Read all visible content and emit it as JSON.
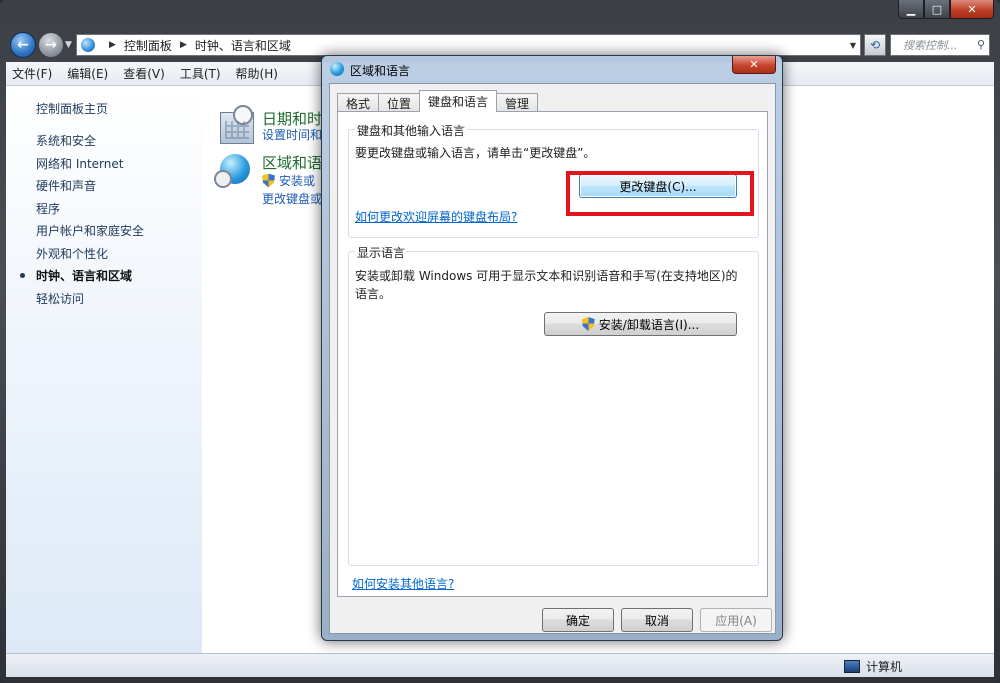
{
  "explorer": {
    "caption": {
      "minimize": "▁",
      "maximize": "□",
      "close": "✕"
    },
    "address": {
      "root": "控制面板",
      "current": "时钟、语言和区域"
    },
    "search_placeholder": "搜索控制...",
    "menu": [
      "文件(F)",
      "编辑(E)",
      "查看(V)",
      "工具(T)",
      "帮助(H)"
    ],
    "sidebar": {
      "home": "控制面板主页",
      "items": [
        {
          "label": "系统和安全"
        },
        {
          "label": "网络和 Internet"
        },
        {
          "label": "硬件和声音"
        },
        {
          "label": "程序"
        },
        {
          "label": "用户帐户和家庭安全"
        },
        {
          "label": "外观和个性化"
        },
        {
          "label": "时钟、语言和区域",
          "active": true
        },
        {
          "label": "轻松访问"
        }
      ]
    },
    "main": {
      "date_time": {
        "title": "日期和时",
        "link1": "设置时间和"
      },
      "region": {
        "title": "区域和语",
        "link1": "安装或",
        "link2": "更改键盘或"
      }
    },
    "status": {
      "computer": "计算机"
    }
  },
  "dialog": {
    "title": "区域和语言",
    "close": "✕",
    "tabs": [
      {
        "label": "格式"
      },
      {
        "label": "位置"
      },
      {
        "label": "键盘和语言",
        "active": true
      },
      {
        "label": "管理"
      }
    ],
    "keyboard_group": {
      "label": "键盘和其他输入语言",
      "text": "要更改键盘或输入语言，请单击“更改键盘”。",
      "button": "更改键盘(C)...",
      "link": "如何更改欢迎屏幕的键盘布局?"
    },
    "display_group": {
      "label": "显示语言",
      "text": "安装或卸载 Windows 可用于显示文本和识别语音和手写(在支持地区)的语言。",
      "button": "安装/卸载语言(I)..."
    },
    "bottom_link": "如何安装其他语言?",
    "buttons": {
      "ok": "确定",
      "cancel": "取消",
      "apply": "应用(A)"
    }
  },
  "colors": {
    "highlight": "#e3141b",
    "link": "#0066cc",
    "green_title": "#1e6c2e"
  }
}
